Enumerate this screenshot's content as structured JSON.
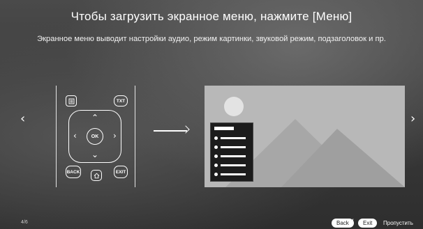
{
  "title": "Чтобы загрузить экранное меню, нажмите [Меню]",
  "subtitle": "Экранное меню выводит настройки аудио, режим картинки, звуковой режим, подзаголовок и пр.",
  "nav": {
    "prev_icon": "‹",
    "next_icon": "›"
  },
  "remote": {
    "menu_icon": "menu-icon",
    "txt_label": "TXT",
    "ok_label": "OK",
    "back_label": "BACK",
    "home_icon": "home-icon",
    "exit_label": "EXIT"
  },
  "footer": {
    "page_indicator": "4/6",
    "back_label": "Back",
    "exit_label": "Exit",
    "skip_label": "Пропустить"
  }
}
